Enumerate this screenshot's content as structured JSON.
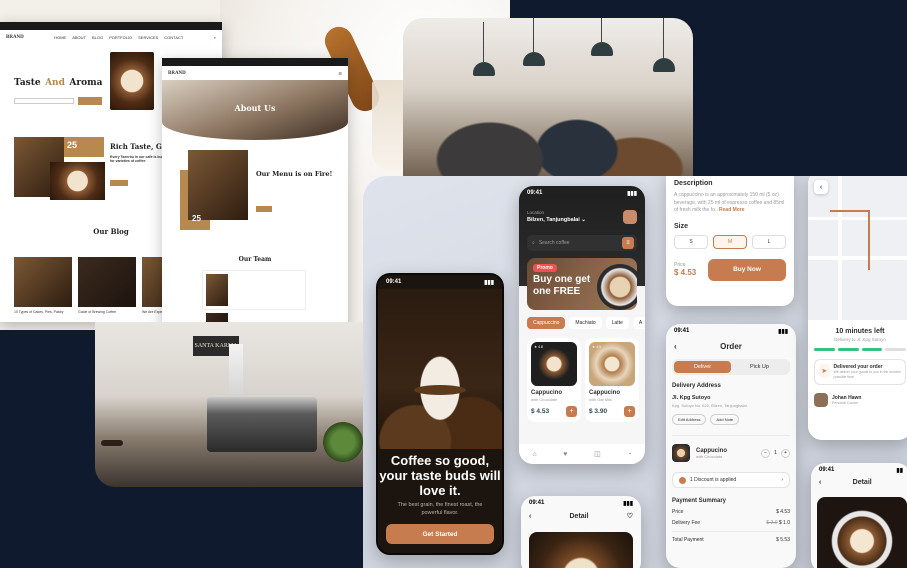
{
  "website": {
    "home": {
      "brand": "BRAND",
      "nav": [
        "HOME",
        "ABOUT",
        "BLOG",
        "PORTFOLIO",
        "SERVICES",
        "CONTACT"
      ],
      "hero_title_a": "Taste",
      "hero_title_and": "And",
      "hero_title_b": "Aroma",
      "about_years": "25",
      "about_title": "Rich Taste, Great",
      "about_text": "Every Taeerbu in our cafe is built for varieties of coffee",
      "blog_title": "Our Blog",
      "blog_items": [
        "10 Types of Cakes, Pies, Pastry",
        "Guide of Brewing Coffee",
        "We Are Experts"
      ]
    },
    "about": {
      "brand": "BRAND",
      "hero": "About Us",
      "menu_title": "Our Menu is on Fire!",
      "years": "25",
      "team_title": "Our Team"
    }
  },
  "shop_sign": "SANTA KARMA",
  "splash": {
    "time": "09:41",
    "headline": "Coffee so good, your taste buds will love it.",
    "subtitle": "The best grain, the finest roast, the powerful flavor.",
    "cta": "Get Started"
  },
  "home": {
    "time": "09:41",
    "location_label": "Location",
    "location_value": "Bilzen, Tanjungbalai",
    "search_placeholder": "Search coffee",
    "promo_badge": "Promo",
    "promo_text": "Buy one get one FREE",
    "tabs": [
      "Cappuccino",
      "Machiato",
      "Latte",
      "A"
    ],
    "products": [
      {
        "rating": "★ 4.8",
        "name": "Cappucino",
        "sub": "with Chocolate",
        "price": "$ 4.53"
      },
      {
        "rating": "★ 4.9",
        "name": "Cappucino",
        "sub": "with Oat Milk",
        "price": "$ 3.90"
      }
    ]
  },
  "detail_small": {
    "time": "09:41",
    "title": "Detail"
  },
  "description": {
    "heading": "Description",
    "text": "A cappuccino is an approximately 150 ml (5 oz) beverage, with 25 ml of espresso coffee and 85ml of fresh milk the fo..",
    "read_more": "Read More",
    "size_heading": "Size",
    "sizes": [
      "S",
      "M",
      "L"
    ],
    "price_label": "Price",
    "price": "$ 4.53",
    "buy": "Buy Now"
  },
  "order": {
    "time": "09:41",
    "title": "Order",
    "toggle": [
      "Deliver",
      "Pick Up"
    ],
    "address_heading": "Delivery Address",
    "address": "Jl. Kpg Sutoyo",
    "address_detail": "Kpg. Sutoyo No. 620, Bilzen, Tanjungbalai.",
    "edit": "Edit Address",
    "note": "Add Note",
    "item_name": "Cappucino",
    "item_sub": "with Chocolate",
    "qty": "1",
    "discount": "1 Discount is applied",
    "summary_heading": "Payment Summary",
    "price_label": "Price",
    "price_value": "$ 4.53",
    "fee_label": "Delivery Fee",
    "fee_old": "$ 2.0",
    "fee_new": "$ 1.0",
    "total_label": "Total Payment",
    "total_value": "$ 5.53"
  },
  "tracking": {
    "eta": "10 minutes left",
    "deliver_to": "Delivery to Jl. Kpg Sutoyo",
    "status_title": "Delivered your order",
    "status_text": "We deliver your goods to you in the shortes possible time.",
    "courier_name": "Johan Hawn",
    "courier_role": "Personal Courier"
  },
  "detail_large": {
    "time": "09:41",
    "title": "Detail"
  },
  "colors": {
    "accent": "#C67C4E",
    "dark": "#1f1f1f",
    "gold": "#B8894E",
    "background": "#0f1a2e"
  }
}
